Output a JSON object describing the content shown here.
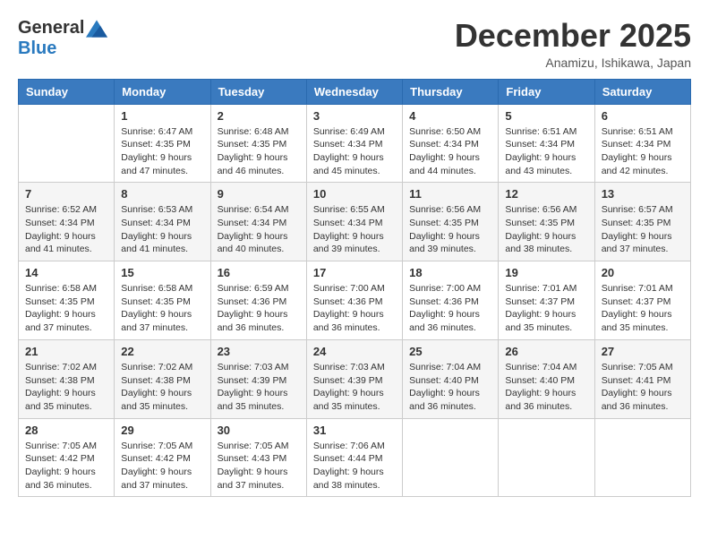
{
  "logo": {
    "general": "General",
    "blue": "Blue"
  },
  "title": "December 2025",
  "location": "Anamizu, Ishikawa, Japan",
  "headers": [
    "Sunday",
    "Monday",
    "Tuesday",
    "Wednesday",
    "Thursday",
    "Friday",
    "Saturday"
  ],
  "weeks": [
    [
      {
        "day": "",
        "info": ""
      },
      {
        "day": "1",
        "info": "Sunrise: 6:47 AM\nSunset: 4:35 PM\nDaylight: 9 hours\nand 47 minutes."
      },
      {
        "day": "2",
        "info": "Sunrise: 6:48 AM\nSunset: 4:35 PM\nDaylight: 9 hours\nand 46 minutes."
      },
      {
        "day": "3",
        "info": "Sunrise: 6:49 AM\nSunset: 4:34 PM\nDaylight: 9 hours\nand 45 minutes."
      },
      {
        "day": "4",
        "info": "Sunrise: 6:50 AM\nSunset: 4:34 PM\nDaylight: 9 hours\nand 44 minutes."
      },
      {
        "day": "5",
        "info": "Sunrise: 6:51 AM\nSunset: 4:34 PM\nDaylight: 9 hours\nand 43 minutes."
      },
      {
        "day": "6",
        "info": "Sunrise: 6:51 AM\nSunset: 4:34 PM\nDaylight: 9 hours\nand 42 minutes."
      }
    ],
    [
      {
        "day": "7",
        "info": "Sunrise: 6:52 AM\nSunset: 4:34 PM\nDaylight: 9 hours\nand 41 minutes."
      },
      {
        "day": "8",
        "info": "Sunrise: 6:53 AM\nSunset: 4:34 PM\nDaylight: 9 hours\nand 41 minutes."
      },
      {
        "day": "9",
        "info": "Sunrise: 6:54 AM\nSunset: 4:34 PM\nDaylight: 9 hours\nand 40 minutes."
      },
      {
        "day": "10",
        "info": "Sunrise: 6:55 AM\nSunset: 4:34 PM\nDaylight: 9 hours\nand 39 minutes."
      },
      {
        "day": "11",
        "info": "Sunrise: 6:56 AM\nSunset: 4:35 PM\nDaylight: 9 hours\nand 39 minutes."
      },
      {
        "day": "12",
        "info": "Sunrise: 6:56 AM\nSunset: 4:35 PM\nDaylight: 9 hours\nand 38 minutes."
      },
      {
        "day": "13",
        "info": "Sunrise: 6:57 AM\nSunset: 4:35 PM\nDaylight: 9 hours\nand 37 minutes."
      }
    ],
    [
      {
        "day": "14",
        "info": "Sunrise: 6:58 AM\nSunset: 4:35 PM\nDaylight: 9 hours\nand 37 minutes."
      },
      {
        "day": "15",
        "info": "Sunrise: 6:58 AM\nSunset: 4:35 PM\nDaylight: 9 hours\nand 37 minutes."
      },
      {
        "day": "16",
        "info": "Sunrise: 6:59 AM\nSunset: 4:36 PM\nDaylight: 9 hours\nand 36 minutes."
      },
      {
        "day": "17",
        "info": "Sunrise: 7:00 AM\nSunset: 4:36 PM\nDaylight: 9 hours\nand 36 minutes."
      },
      {
        "day": "18",
        "info": "Sunrise: 7:00 AM\nSunset: 4:36 PM\nDaylight: 9 hours\nand 36 minutes."
      },
      {
        "day": "19",
        "info": "Sunrise: 7:01 AM\nSunset: 4:37 PM\nDaylight: 9 hours\nand 35 minutes."
      },
      {
        "day": "20",
        "info": "Sunrise: 7:01 AM\nSunset: 4:37 PM\nDaylight: 9 hours\nand 35 minutes."
      }
    ],
    [
      {
        "day": "21",
        "info": "Sunrise: 7:02 AM\nSunset: 4:38 PM\nDaylight: 9 hours\nand 35 minutes."
      },
      {
        "day": "22",
        "info": "Sunrise: 7:02 AM\nSunset: 4:38 PM\nDaylight: 9 hours\nand 35 minutes."
      },
      {
        "day": "23",
        "info": "Sunrise: 7:03 AM\nSunset: 4:39 PM\nDaylight: 9 hours\nand 35 minutes."
      },
      {
        "day": "24",
        "info": "Sunrise: 7:03 AM\nSunset: 4:39 PM\nDaylight: 9 hours\nand 35 minutes."
      },
      {
        "day": "25",
        "info": "Sunrise: 7:04 AM\nSunset: 4:40 PM\nDaylight: 9 hours\nand 36 minutes."
      },
      {
        "day": "26",
        "info": "Sunrise: 7:04 AM\nSunset: 4:40 PM\nDaylight: 9 hours\nand 36 minutes."
      },
      {
        "day": "27",
        "info": "Sunrise: 7:05 AM\nSunset: 4:41 PM\nDaylight: 9 hours\nand 36 minutes."
      }
    ],
    [
      {
        "day": "28",
        "info": "Sunrise: 7:05 AM\nSunset: 4:42 PM\nDaylight: 9 hours\nand 36 minutes."
      },
      {
        "day": "29",
        "info": "Sunrise: 7:05 AM\nSunset: 4:42 PM\nDaylight: 9 hours\nand 37 minutes."
      },
      {
        "day": "30",
        "info": "Sunrise: 7:05 AM\nSunset: 4:43 PM\nDaylight: 9 hours\nand 37 minutes."
      },
      {
        "day": "31",
        "info": "Sunrise: 7:06 AM\nSunset: 4:44 PM\nDaylight: 9 hours\nand 38 minutes."
      },
      {
        "day": "",
        "info": ""
      },
      {
        "day": "",
        "info": ""
      },
      {
        "day": "",
        "info": ""
      }
    ]
  ]
}
